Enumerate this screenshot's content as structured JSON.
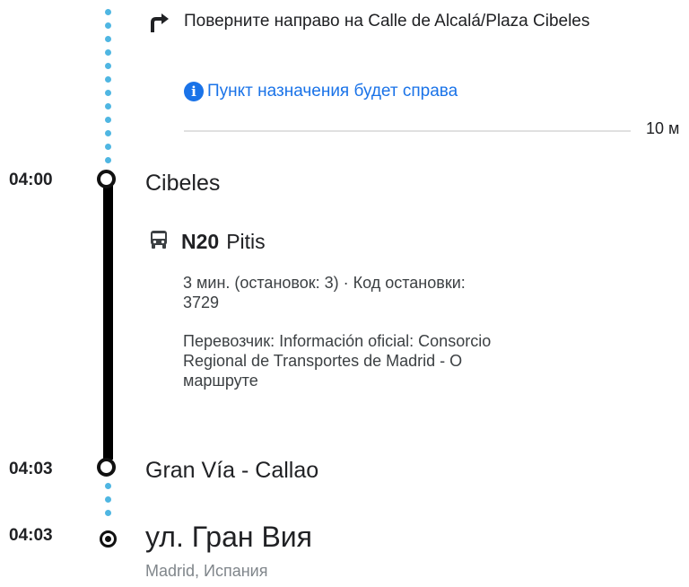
{
  "step": {
    "instruction": "Поверните направо на Calle de Alcalá/Plaza Cibeles",
    "note": "Пункт назначения будет справа",
    "distance": "10 м",
    "icon": "turn-right-arrow-icon"
  },
  "stops": [
    {
      "time": "04:00",
      "name": "Cibeles"
    },
    {
      "time": "04:03",
      "name": "Gran Vía - Callao"
    }
  ],
  "transit": {
    "route_number": "N20",
    "route_destination": "Pitis",
    "duration_line1": "3 мин. (остановок: 3) · Код остановки:",
    "duration_line2": "3729",
    "operator_line1": "Перевозчик: Información oficial: Consorcio",
    "operator_line2": "Regional de Transportes de Madrid - О",
    "operator_line3": "маршруте",
    "icon": "bus-icon"
  },
  "destination": {
    "time": "04:03",
    "name": "ул. Гран Вия",
    "subtitle": "Madrid, Испания"
  },
  "colors": {
    "walk_dots": "#4fb6e2",
    "transit_line": "#000000",
    "link": "#1a73e8"
  }
}
